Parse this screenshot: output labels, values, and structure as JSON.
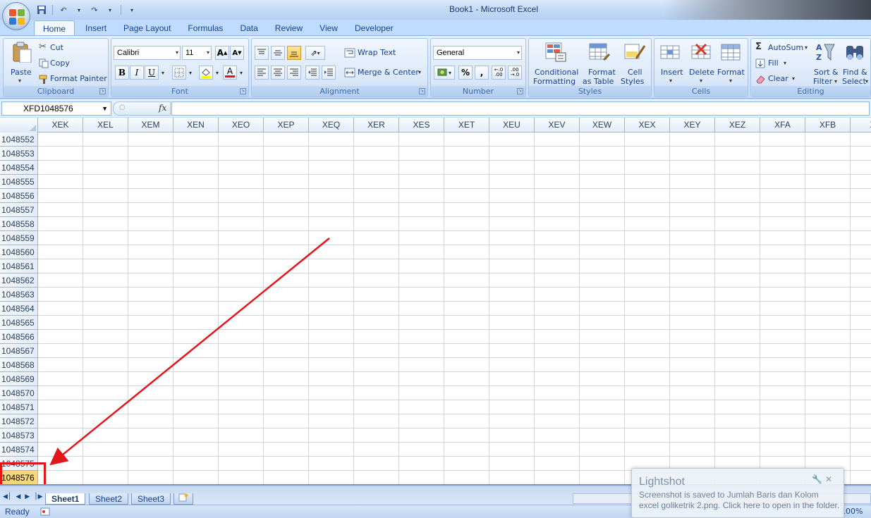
{
  "window": {
    "title": "Book1 - Microsoft Excel"
  },
  "qat": [
    "save-icon",
    "undo-icon",
    "redo-icon",
    "customize-icon"
  ],
  "tabs": [
    "Home",
    "Insert",
    "Page Layout",
    "Formulas",
    "Data",
    "Review",
    "View",
    "Developer"
  ],
  "clipboard": {
    "paste": "Paste",
    "cut": "Cut",
    "copy": "Copy",
    "format_painter": "Format Painter",
    "label": "Clipboard"
  },
  "font": {
    "name": "Calibri",
    "size": "11",
    "bold": "B",
    "italic": "I",
    "underline": "U",
    "color_glyph": "A",
    "label": "Font"
  },
  "alignment": {
    "wrap_text": "Wrap Text",
    "merge_center": "Merge & Center",
    "label": "Alignment"
  },
  "number": {
    "format": "General",
    "percent": "%",
    "comma": ",",
    "inc_decimal": ".0→.00",
    "dec_decimal": ".00→.0",
    "label": "Number"
  },
  "styles": {
    "conditional_1": "Conditional",
    "conditional_2": "Formatting",
    "format_table_1": "Format",
    "format_table_2": "as Table",
    "cell_styles_1": "Cell",
    "cell_styles_2": "Styles",
    "label": "Styles"
  },
  "cells": {
    "insert": "Insert",
    "delete": "Delete",
    "format": "Format",
    "label": "Cells"
  },
  "editing": {
    "autosum": "AutoSum",
    "fill": "Fill",
    "clear": "Clear",
    "sort_1": "Sort &",
    "sort_2": "Filter",
    "find_1": "Find &",
    "find_2": "Select",
    "label": "Editing"
  },
  "formula_bar": {
    "name_box": "XFD1048576",
    "fx": "fx",
    "value": ""
  },
  "columns": [
    "XEK",
    "XEL",
    "XEM",
    "XEN",
    "XEO",
    "XEP",
    "XEQ",
    "XER",
    "XES",
    "XET",
    "XEU",
    "XEV",
    "XEW",
    "XEX",
    "XEY",
    "XEZ",
    "XFA",
    "XFB",
    "X"
  ],
  "rows": [
    "1048552",
    "1048553",
    "1048554",
    "1048555",
    "1048556",
    "1048557",
    "1048558",
    "1048559",
    "1048560",
    "1048561",
    "1048562",
    "1048563",
    "1048564",
    "1048565",
    "1048566",
    "1048567",
    "1048568",
    "1048569",
    "1048570",
    "1048571",
    "1048572",
    "1048573",
    "1048574",
    "1048575",
    "1048576"
  ],
  "selected_row": "1048576",
  "sheets": [
    "Sheet1",
    "Sheet2",
    "Sheet3"
  ],
  "active_sheet": "Sheet1",
  "status": {
    "ready": "Ready",
    "zoom": "100%"
  },
  "lightshot": {
    "title": "Lightshot",
    "message": "Screenshot is saved to Jumlah Baris dan Kolom excel goliketrik 2.png. Click here to open in the folder."
  },
  "colors": {
    "annotation": "#e4151a",
    "selected_row": "#f8d67f",
    "ribbon": "#d6e5f8"
  }
}
